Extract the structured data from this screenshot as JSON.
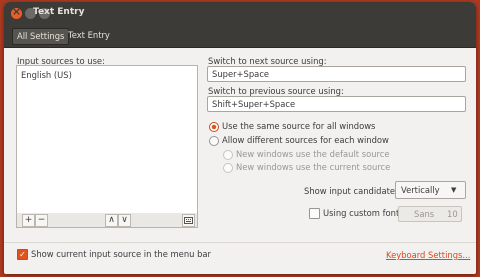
{
  "window": {
    "title": "Text Entry"
  },
  "toolbar": {
    "breadcrumbs": [
      "All Settings",
      "Text Entry"
    ]
  },
  "sources": {
    "label": "Input sources to use:",
    "items": [
      "English (US)"
    ],
    "buttons": {
      "add": "+",
      "remove": "−",
      "up": "∧",
      "down": "∨"
    }
  },
  "switching": {
    "next_label": "Switch to next source using:",
    "next_value": "Super+Space",
    "prev_label": "Switch to previous source using:",
    "prev_value": "Shift+Super+Space"
  },
  "options": {
    "same_source": "Use the same source for all windows",
    "different_sources": "Allow different sources for each window",
    "new_default": "New windows use the default source",
    "new_current": "New windows use the current source",
    "selected": "same_source"
  },
  "candidates": {
    "label": "Show input candidates:",
    "value": "Vertically"
  },
  "custom_font": {
    "label": "Using custom font:",
    "checked": false,
    "font_name": "Sans",
    "font_size": "10"
  },
  "menu_bar": {
    "label": "Show current input source in the menu bar",
    "checked": true
  },
  "keyboard_link": "Keyboard Settings...",
  "colors": {
    "accent": "#dd4814",
    "titlebar": "#3c3b37",
    "window_bg": "#f2f1f0"
  }
}
